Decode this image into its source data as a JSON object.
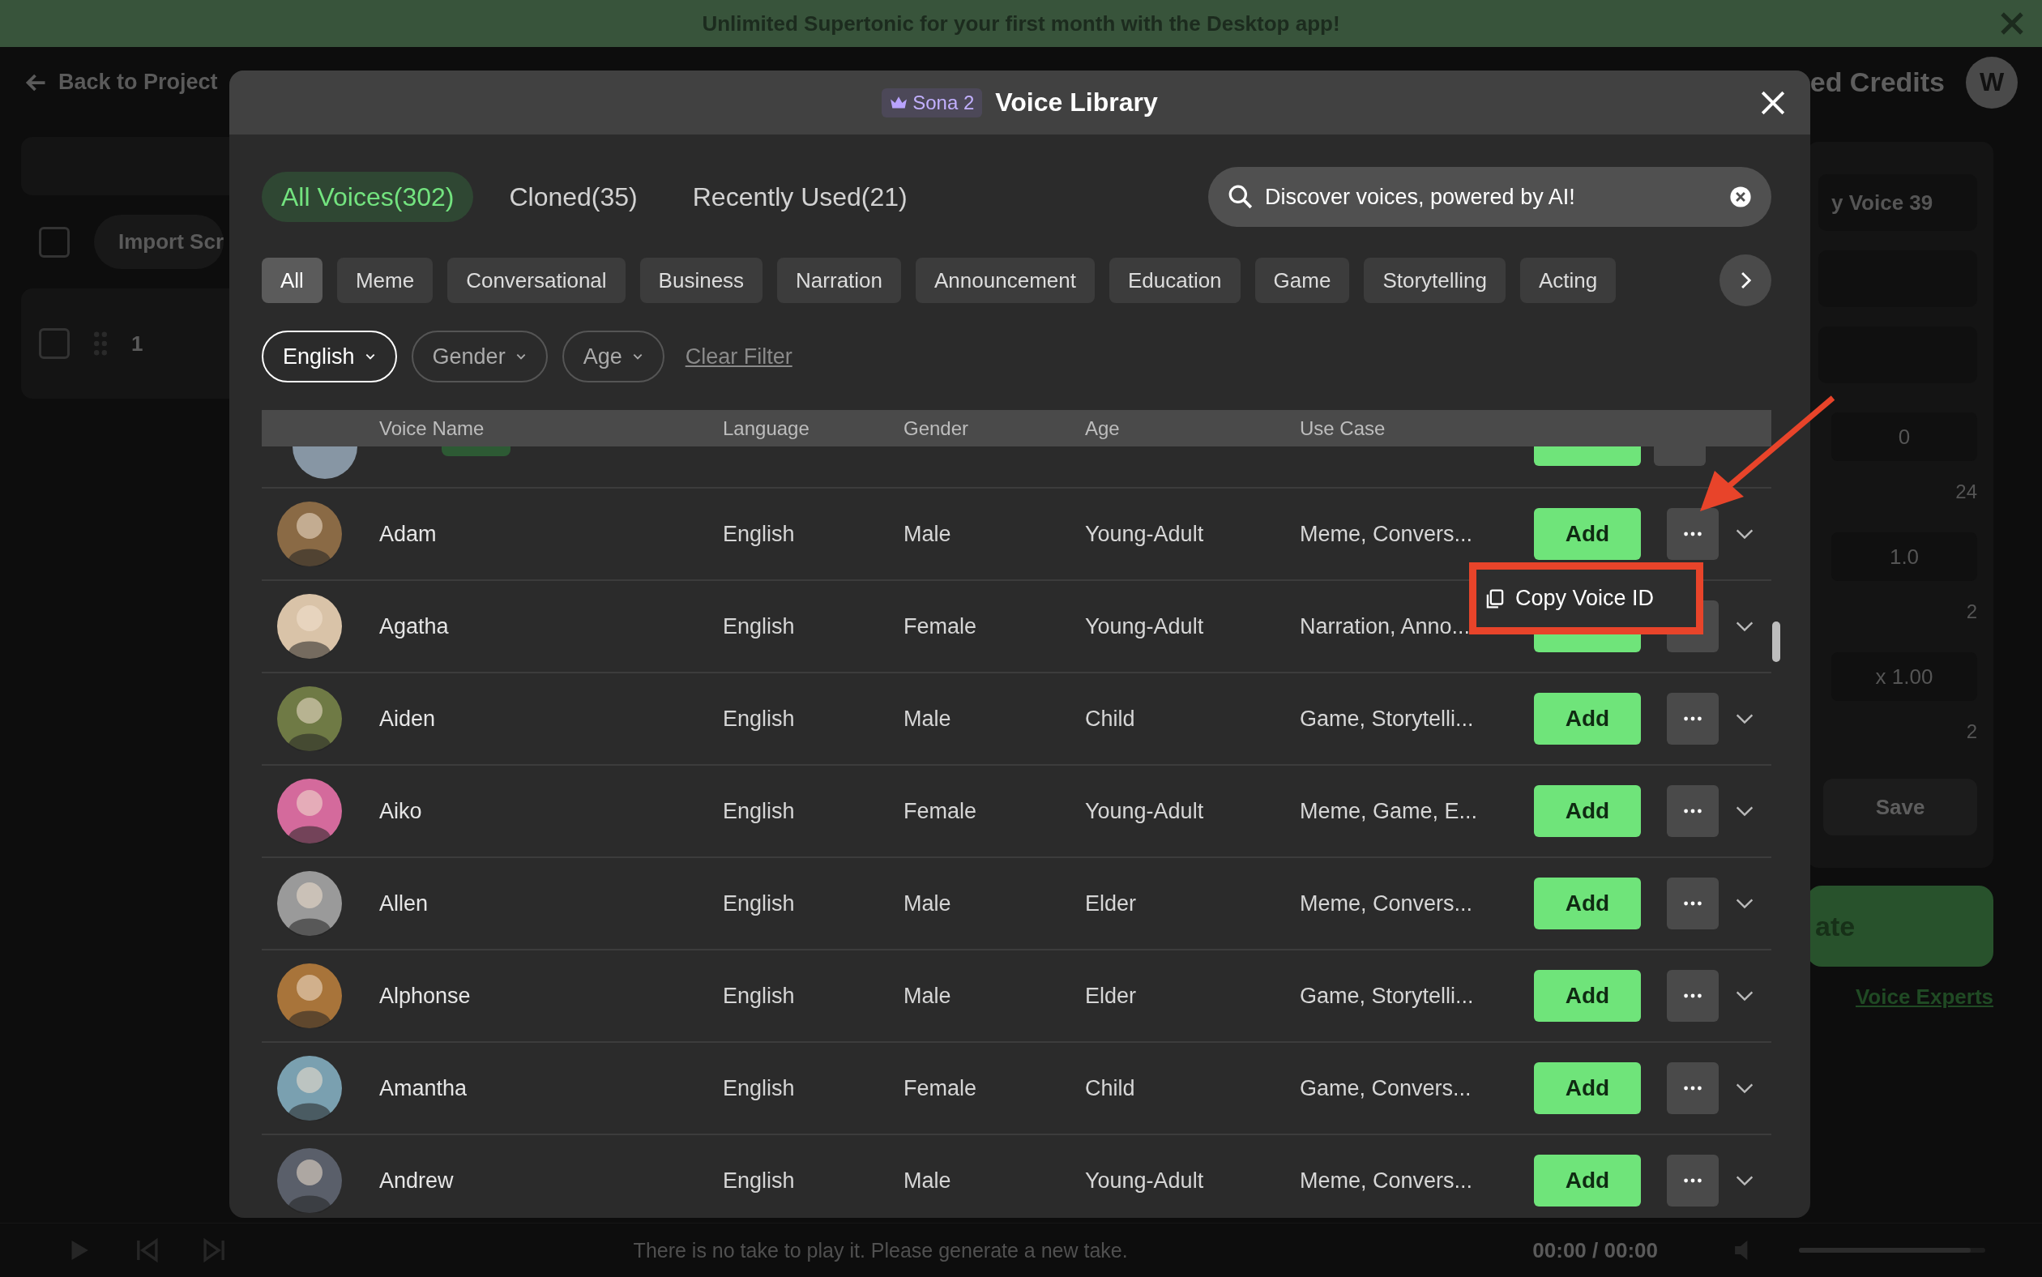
{
  "banner": {
    "text": "Unlimited Supertonic for your first month with the Desktop app!"
  },
  "topbar": {
    "back": "Back to Project",
    "credits": "ed Credits",
    "avatar": "W"
  },
  "script_panel": {
    "import": "Import Scr",
    "row_number": "1",
    "all_checked": false,
    "row_checked": false
  },
  "settings_panel": {
    "voice": "y Voice 39",
    "pitch": "0",
    "pitch_max": "24",
    "speed": "1.0",
    "speed_max": "2",
    "rate": "x 1.00",
    "rate_max": "2",
    "save": "Save",
    "generate": "ate",
    "link": "Voice Experts"
  },
  "player": {
    "message": "There is no take to play it. Please generate a new take.",
    "time": "00:00 / 00:00",
    "volume": {
      "level": 0.92
    }
  },
  "dialog": {
    "badge": "Sona 2",
    "title": "Voice Library",
    "tabs": [
      {
        "label": "All Voices(302)",
        "selected": true
      },
      {
        "label": "Cloned(35)",
        "selected": false
      },
      {
        "label": "Recently Used(21)",
        "selected": false
      }
    ],
    "search": {
      "value": "Discover voices, powered by AI!"
    },
    "categories": [
      {
        "label": "All",
        "selected": true
      },
      {
        "label": "Meme",
        "selected": false
      },
      {
        "label": "Conversational",
        "selected": false
      },
      {
        "label": "Business",
        "selected": false
      },
      {
        "label": "Narration",
        "selected": false
      },
      {
        "label": "Announcement",
        "selected": false
      },
      {
        "label": "Education",
        "selected": false
      },
      {
        "label": "Game",
        "selected": false
      },
      {
        "label": "Storytelling",
        "selected": false
      },
      {
        "label": "Acting",
        "selected": false
      }
    ],
    "filters": [
      {
        "label": "English",
        "selected": true
      },
      {
        "label": "Gender",
        "selected": false
      },
      {
        "label": "Age",
        "selected": false
      }
    ],
    "clear_filter": "Clear Filter",
    "columns": [
      "Voice Name",
      "Language",
      "Gender",
      "Age",
      "Use Case"
    ],
    "voices": [
      {
        "name": "Adam",
        "language": "English",
        "gender": "Male",
        "age": "Young-Adult",
        "use_case": "Meme, Convers...",
        "add": "Add",
        "color": "#8a6a45"
      },
      {
        "name": "Agatha",
        "language": "English",
        "gender": "Female",
        "age": "Young-Adult",
        "use_case": "Narration, Anno...",
        "color": "#d9c3a8"
      },
      {
        "name": "Aiden",
        "language": "English",
        "gender": "Male",
        "age": "Child",
        "use_case": "Game, Storytelli...",
        "add": "Add",
        "color": "#6f7a45"
      },
      {
        "name": "Aiko",
        "language": "English",
        "gender": "Female",
        "age": "Young-Adult",
        "use_case": "Meme, Game, E...",
        "add": "Add",
        "color": "#d46a9c"
      },
      {
        "name": "Allen",
        "language": "English",
        "gender": "Male",
        "age": "Elder",
        "use_case": "Meme, Convers...",
        "add": "Add",
        "color": "#9a9a9a"
      },
      {
        "name": "Alphonse",
        "language": "English",
        "gender": "Male",
        "age": "Elder",
        "use_case": "Game, Storytelli...",
        "add": "Add",
        "color": "#a8743a"
      },
      {
        "name": "Amantha",
        "language": "English",
        "gender": "Female",
        "age": "Child",
        "use_case": "Game, Convers...",
        "add": "Add",
        "color": "#7aa0b0"
      },
      {
        "name": "Andrew",
        "language": "English",
        "gender": "Male",
        "age": "Young-Adult",
        "use_case": "Meme, Convers...",
        "add": "Add",
        "color": "#5a5f6a"
      }
    ],
    "menu": {
      "item": "Copy Voice ID"
    }
  }
}
